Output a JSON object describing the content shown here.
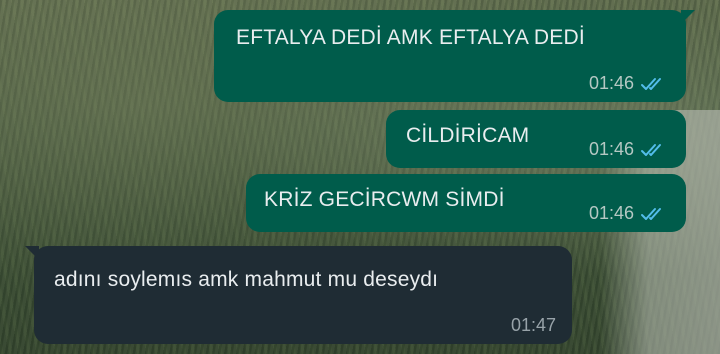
{
  "chat": {
    "messages": [
      {
        "direction": "outgoing",
        "text": "EFTALYA DEDİ AMK EFTALYA DEDİ",
        "time": "01:46",
        "status_icon": "double-check-icon"
      },
      {
        "direction": "outgoing",
        "text": "CİLDİRİCAM",
        "time": "01:46",
        "status_icon": "double-check-icon"
      },
      {
        "direction": "outgoing",
        "text": "KRİZ GECİRCWM SİMDİ",
        "time": "01:46",
        "status_icon": "double-check-icon"
      },
      {
        "direction": "incoming",
        "text": "adını soylemıs amk mahmut mu deseydı",
        "time": "01:47"
      }
    ]
  },
  "colors": {
    "outgoing_bubble": "#005c4b",
    "incoming_bubble": "#1f2c34",
    "read_ticks": "#53bdeb"
  }
}
